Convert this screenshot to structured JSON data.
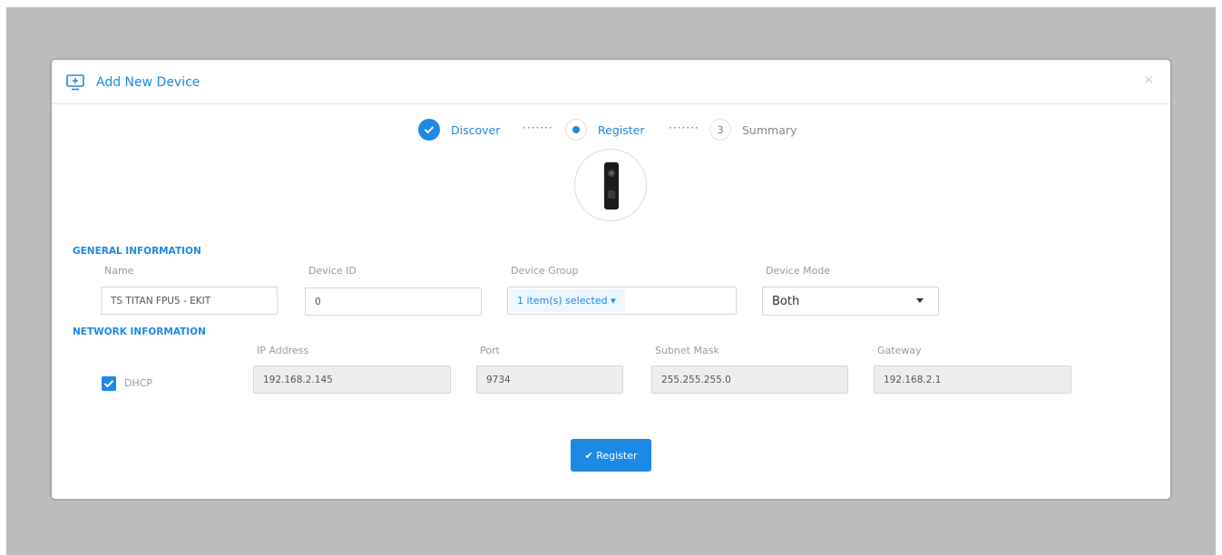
{
  "modal": {
    "title": "Add New Device",
    "close_glyph": "×"
  },
  "stepper": {
    "steps": [
      {
        "label": "Discover",
        "state": "completed"
      },
      {
        "label": "Register",
        "state": "active"
      },
      {
        "label": "Summary",
        "state": "pending",
        "number": "3"
      }
    ],
    "connector": "·······"
  },
  "general": {
    "section_title": "GENERAL INFORMATION",
    "name_label": "Name",
    "name_value": "TS TITAN FPU5 - EKIT",
    "device_id_label": "Device ID",
    "device_id_value": "0",
    "device_group_label": "Device Group",
    "device_group_value": "1 item(s) selected ▾",
    "device_mode_label": "Device Mode",
    "device_mode_value": "Both"
  },
  "network": {
    "section_title": "NETWORK INFORMATION",
    "dhcp_label": "DHCP",
    "dhcp_checked": true,
    "ip_label": "IP Address",
    "ip_value": "192.168.2.145",
    "port_label": "Port",
    "port_value": "9734",
    "subnet_label": "Subnet Mask",
    "subnet_value": "255.255.255.0",
    "gateway_label": "Gateway",
    "gateway_value": "192.168.2.1"
  },
  "actions": {
    "register_label": "✔ Register"
  },
  "icons": {
    "header": "add-device-monitor-icon",
    "close": "close-icon",
    "step_done": "check-icon",
    "step_active": "dot-icon",
    "device": "fingerprint-terminal-image",
    "select_caret": "chevron-down-icon",
    "checkbox": "check-icon"
  },
  "colors": {
    "accent": "#1e88e5",
    "overlay": "#bdbdbd",
    "disabled_input": "#eeeeee"
  }
}
